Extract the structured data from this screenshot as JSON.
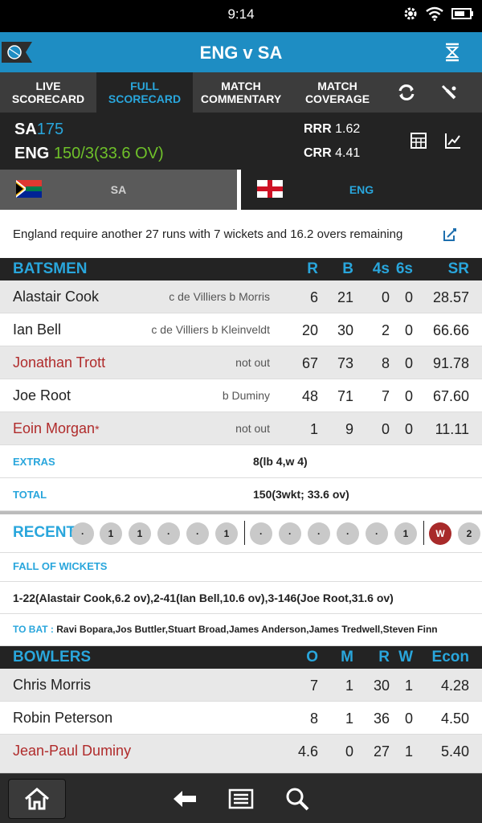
{
  "status_bar": {
    "time": "9:14"
  },
  "header": {
    "title": "ENG v SA"
  },
  "tabs": [
    {
      "line1": "LIVE",
      "line2": "SCORECARD"
    },
    {
      "line1": "FULL",
      "line2": "SCORECARD"
    },
    {
      "line1": "MATCH",
      "line2": "COMMENTARY"
    },
    {
      "line1": "MATCH",
      "line2": "COVERAGE"
    }
  ],
  "summary": {
    "team1": "SA",
    "team1_score": "175",
    "team2": "ENG",
    "team2_score": "150/3(33.6 OV)",
    "rrr_label": "RRR",
    "rrr_value": "1.62",
    "crr_label": "CRR",
    "crr_value": "4.41"
  },
  "team_tabs": {
    "left": "SA",
    "right": "ENG"
  },
  "require_text": "England require another 27 runs with 7 wickets and 16.2 overs remaining",
  "batsmen": {
    "title": "BATSMEN",
    "cols": [
      "R",
      "B",
      "4s",
      "6s",
      "SR"
    ],
    "rows": [
      {
        "name": "Alastair Cook",
        "dismissal": "c de Villiers b Morris",
        "r": "6",
        "b": "21",
        "fours": "0",
        "sixes": "0",
        "sr": "28.57"
      },
      {
        "name": "Ian Bell",
        "dismissal": "c de Villiers b Kleinveldt",
        "r": "20",
        "b": "30",
        "fours": "2",
        "sixes": "0",
        "sr": "66.66"
      },
      {
        "name": "Jonathan Trott",
        "dismissal": "not out",
        "r": "67",
        "b": "73",
        "fours": "8",
        "sixes": "0",
        "sr": "91.78"
      },
      {
        "name": "Joe Root",
        "dismissal": "b Duminy",
        "r": "48",
        "b": "71",
        "fours": "7",
        "sixes": "0",
        "sr": "67.60"
      },
      {
        "name": "Eoin Morgan",
        "dismissal": "not out",
        "r": "1",
        "b": "9",
        "fours": "0",
        "sixes": "0",
        "sr": "11.11"
      }
    ],
    "captain_mark": "*"
  },
  "extras": {
    "label": "EXTRAS",
    "value": "8(lb 4,w 4)"
  },
  "total": {
    "label": "TOTAL",
    "value": "150(3wkt; 33.6 ov)"
  },
  "recent": {
    "label": "RECENT",
    "balls": [
      "·",
      "1",
      "1",
      "·",
      "·",
      "1",
      "·",
      "·",
      "·",
      "·",
      "·",
      "1",
      "W",
      "2"
    ]
  },
  "fall_of_wickets": {
    "label": "FALL OF WICKETS",
    "value": "1-22(Alastair Cook,6.2 ov),2-41(Ian Bell,10.6 ov),3-146(Joe Root,31.6 ov)"
  },
  "to_bat": {
    "label": "TO BAT :",
    "value": "Ravi Bopara,Jos Buttler,Stuart Broad,James Anderson,James Tredwell,Steven Finn"
  },
  "bowlers": {
    "title": "BOWLERS",
    "cols": [
      "O",
      "M",
      "R",
      "W",
      "Econ"
    ],
    "rows": [
      {
        "name": "Chris Morris",
        "o": "7",
        "m": "1",
        "r": "30",
        "w": "1",
        "econ": "4.28"
      },
      {
        "name": "Robin Peterson",
        "o": "8",
        "m": "1",
        "r": "36",
        "w": "0",
        "econ": "4.50"
      },
      {
        "name": "Jean-Paul Duminy",
        "o": "4.6",
        "m": "0",
        "r": "27",
        "w": "1",
        "econ": "5.40"
      }
    ]
  },
  "colors": {
    "accent": "#29a6dc",
    "header": "#1e8dc3",
    "green": "#6fc12a",
    "red": "#b02b2b"
  }
}
